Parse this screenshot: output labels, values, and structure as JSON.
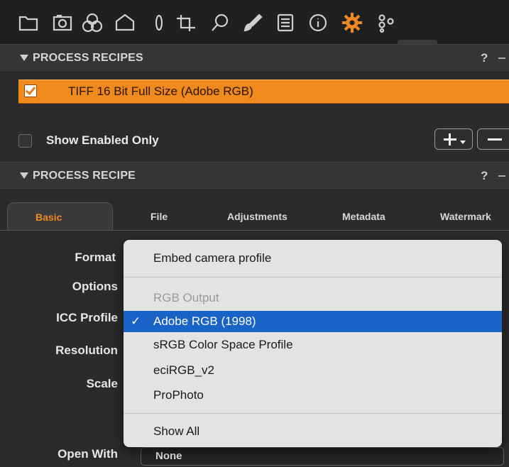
{
  "toolbar": {
    "icons": [
      "folder-icon",
      "camera-icon",
      "color-circles-icon",
      "exposure-icon",
      "lens-icon",
      "crop-icon",
      "search-icon",
      "brush-icon",
      "list-icon",
      "info-icon",
      "gear-icon",
      "batch-icon"
    ],
    "active": "gear-icon",
    "accent": "#f08a1c"
  },
  "recipes_section": {
    "title": "PROCESS RECIPES",
    "help": "?",
    "recipe_label": "TIFF 16 Bit Full Size (Adobe RGB)",
    "show_enabled_label": "Show Enabled Only"
  },
  "recipe_section": {
    "title": "PROCESS RECIPE",
    "help": "?"
  },
  "tabs": [
    "Basic",
    "File",
    "Adjustments",
    "Metadata",
    "Watermark"
  ],
  "form": {
    "format_label": "Format",
    "options_label": "Options",
    "icc_label": "ICC Profile",
    "resolution_label": "Resolution",
    "scale_label": "Scale",
    "open_with_label": "Open With",
    "open_with_value": "None"
  },
  "menu": {
    "embed": "Embed camera profile",
    "group_header": "RGB Output",
    "items": [
      "Adobe RGB (1998)",
      "sRGB Color Space Profile",
      "eciRGB_v2",
      "ProPhoto"
    ],
    "selected_check": "✓",
    "show_all": "Show All"
  }
}
